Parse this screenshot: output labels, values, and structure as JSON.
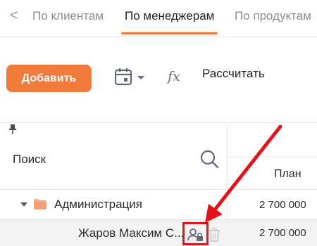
{
  "tabs": {
    "back_glyph": "<",
    "items": [
      {
        "label": "По клиентам",
        "active": false
      },
      {
        "label": "По менеджерам",
        "active": true
      },
      {
        "label": "По продуктам",
        "active": false
      }
    ]
  },
  "toolbar": {
    "add_label": "Добавить",
    "calendar_icon": "calendar-icon",
    "fx_label": "fx",
    "calculate_label": "Рассчитать"
  },
  "table": {
    "search_label": "Поиск",
    "column_plan": "План",
    "rows": [
      {
        "type": "group",
        "name": "Администрация",
        "plan": "2 700 000",
        "expanded": true
      },
      {
        "type": "item",
        "name": "Жаров Максим С...",
        "plan": "2 700 000"
      }
    ]
  },
  "colors": {
    "accent": "#f17a3d",
    "annotation": "#e2141b",
    "row_highlight": "#f3f3f3"
  }
}
